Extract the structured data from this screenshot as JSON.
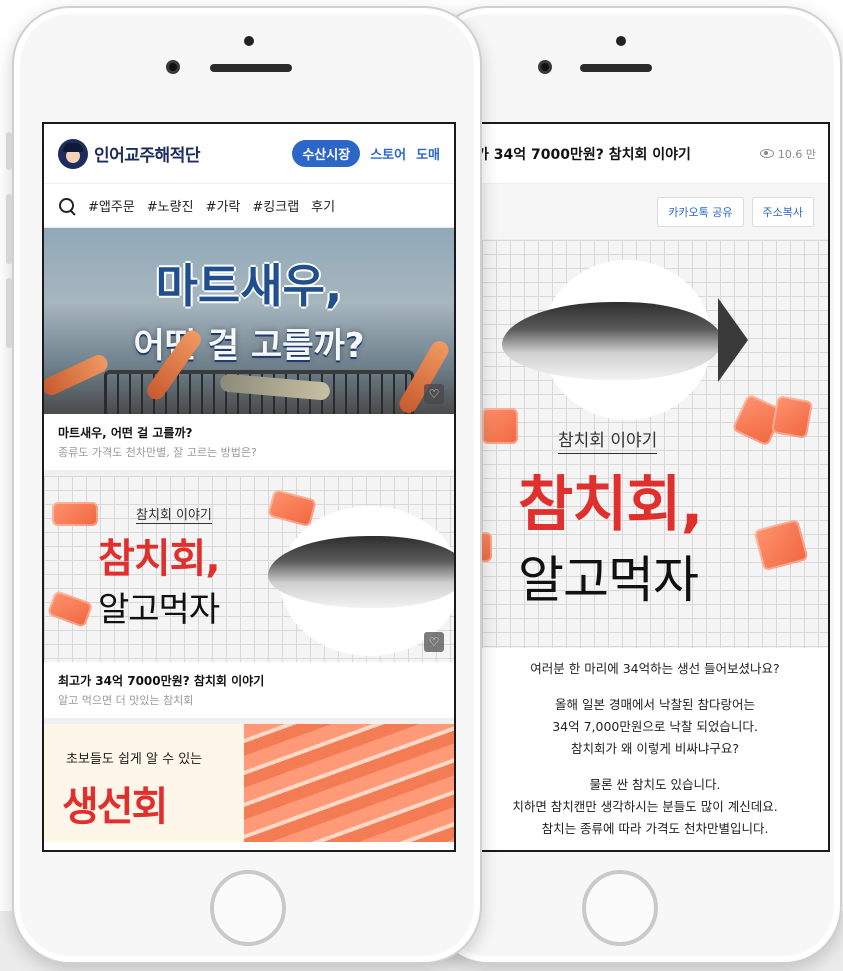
{
  "front": {
    "brand": "인어교주해적단",
    "nav": [
      "수산시장",
      "스토어",
      "도매"
    ],
    "tags": [
      "#앱주문",
      "#노량진",
      "#가락",
      "#킹크랩",
      "후기"
    ],
    "cards": [
      {
        "image_line1": "마트새우,",
        "image_line2": "어떤 걸 고를까?",
        "title": "마트새우, 어떤 걸 고를까?",
        "subtitle": "종류도 가격도 천차만별, 잘 고르는 방법은?"
      },
      {
        "image_label": "참치회 이야기",
        "image_red": "참치회,",
        "image_black": "알고먹자",
        "title": "최고가 34억 7000만원? 참치회 이야기",
        "subtitle": "알고 먹으면 더 맛있는 참치회"
      },
      {
        "image_line1": "초보들도 쉽게 알 수 있는",
        "image_line2": "생선회"
      }
    ]
  },
  "back": {
    "title": "가 34억 7000만원? 참치회 이야기",
    "views": "10.6 만",
    "share_buttons": [
      "카카오톡 공유",
      "주소복사"
    ],
    "image_label": "참치회 이야기",
    "image_red": "참치회,",
    "image_black": "알고먹자",
    "paragraphs": [
      [
        "여러분 한 마리에 34억하는 생선 들어보셨나요?"
      ],
      [
        "올해 일본 경매에서 낙찰된 참다랑어는",
        "34억 7,000만원으로 낙찰 되었습니다.",
        "참치회가 왜 이렇게 비싸냐구요?"
      ],
      [
        "물론 싼 참치도 있습니다.",
        "치하면 참치캔만 생각하시는 분들도 많이 계신데요.",
        "참치는 종류에 따라 가격도 천차만별입니다."
      ]
    ]
  },
  "colors": {
    "accent": "#2c67c8",
    "title_red": "#e0302e",
    "brand_navy": "#1d2e5c"
  },
  "icons": [
    "search-icon",
    "heart-icon",
    "eye-icon",
    "camera-icon",
    "home-button-icon"
  ]
}
